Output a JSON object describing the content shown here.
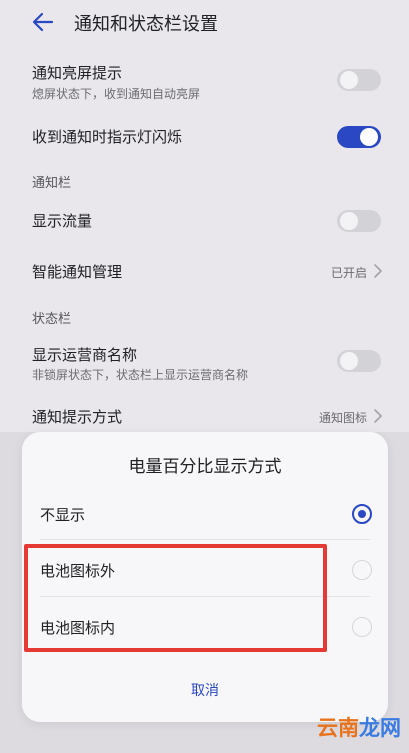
{
  "header": {
    "title": "通知和状态栏设置",
    "back_icon": "back-arrow-icon"
  },
  "settings": {
    "screen_on": {
      "label": "通知亮屏提示",
      "desc": "熄屏状态下，收到通知自动亮屏",
      "enabled": false
    },
    "led_blink": {
      "label": "收到通知时指示灯闪烁",
      "enabled": true
    },
    "notification_bar_section": "通知栏",
    "show_traffic": {
      "label": "显示流量",
      "enabled": false
    },
    "smart_notification": {
      "label": "智能通知管理",
      "value": "已开启"
    },
    "status_bar_section": "状态栏",
    "carrier_name": {
      "label": "显示运营商名称",
      "desc": "非锁屏状态下，状态栏上显示运营商名称",
      "enabled": false
    },
    "notify_method": {
      "label": "通知提示方式",
      "value": "通知图标"
    }
  },
  "dialog": {
    "title": "电量百分比显示方式",
    "options": [
      {
        "label": "不显示",
        "selected": true
      },
      {
        "label": "电池图标外",
        "selected": false
      },
      {
        "label": "电池图标内",
        "selected": false
      }
    ],
    "cancel_label": "取消"
  },
  "watermark": {
    "part1": "云南",
    "part2": "龙网"
  },
  "colors": {
    "accent": "#2a48c4",
    "highlight": "#e53935",
    "background": "#e9e7ec"
  }
}
